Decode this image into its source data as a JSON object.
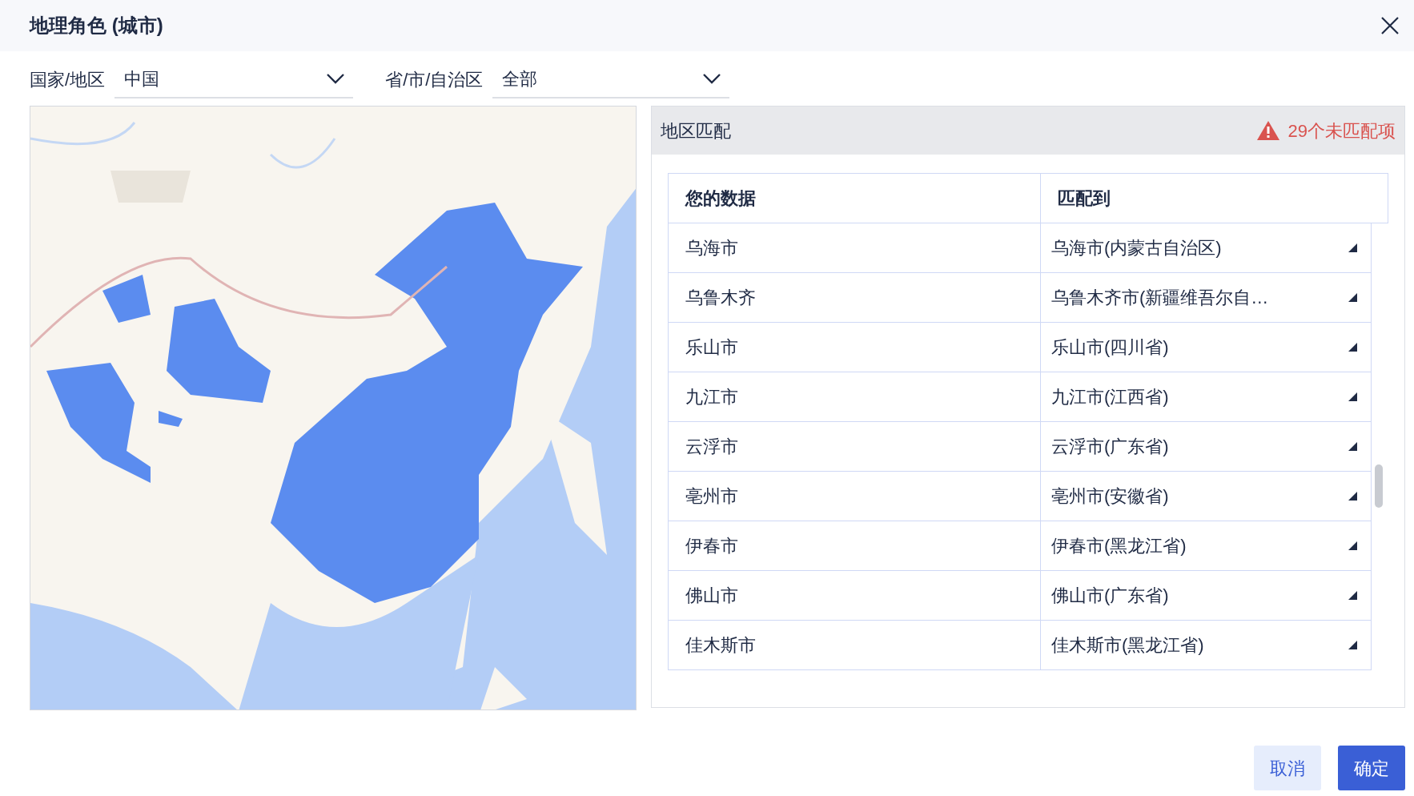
{
  "dialog": {
    "title": "地理角色 (城市)"
  },
  "filters": [
    {
      "label": "国家/地区",
      "value": "中国"
    },
    {
      "label": "省/市/自治区",
      "value": "全部"
    }
  ],
  "match_panel": {
    "title": "地区匹配",
    "warning": "29个未匹配项",
    "columns": [
      "您的数据",
      "匹配到"
    ],
    "rows": [
      {
        "data": "乌海市",
        "match": "乌海市(内蒙古自治区)"
      },
      {
        "data": "乌鲁木齐",
        "match": "乌鲁木齐市(新疆维吾尔自…"
      },
      {
        "data": "乐山市",
        "match": "乐山市(四川省)"
      },
      {
        "data": "九江市",
        "match": "九江市(江西省)"
      },
      {
        "data": "云浮市",
        "match": "云浮市(广东省)"
      },
      {
        "data": "亳州市",
        "match": "亳州市(安徽省)"
      },
      {
        "data": "伊春市",
        "match": "伊春市(黑龙江省)"
      },
      {
        "data": "佛山市",
        "match": "佛山市(广东省)"
      },
      {
        "data": "佳木斯市",
        "match": "佳木斯市(黑龙江省)"
      }
    ]
  },
  "buttons": [
    {
      "label": "取消",
      "kind": "secondary"
    },
    {
      "label": "确定",
      "kind": "primary"
    }
  ]
}
